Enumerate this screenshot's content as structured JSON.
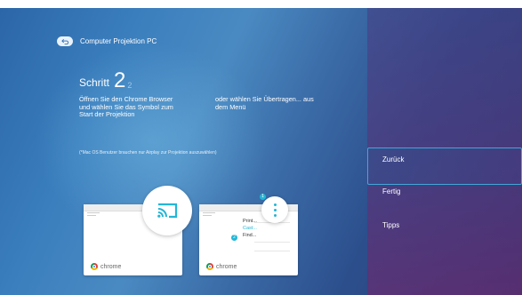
{
  "header": {
    "title": "Computer Projektion PC"
  },
  "step": {
    "label": "Schritt",
    "current": "2",
    "total": "2"
  },
  "instructions": {
    "left": [
      "Öffnen Sie den Chrome Browser",
      "und wählen Sie das Symbol zum",
      "Start der Projektion"
    ],
    "right": [
      "oder wählen Sie Übertragen... aus",
      "dem Menü"
    ]
  },
  "note": "(*Mac OS Benutzer brauchen nur Airplay zur Projektion auszuwählen)",
  "cards": {
    "left": {
      "browser_label": "chrome"
    },
    "right": {
      "browser_label": "chrome",
      "badge1": "1",
      "badge2": "2",
      "menu_items": [
        "Print...",
        "Cast...",
        "Find..."
      ]
    }
  },
  "nav": {
    "items": [
      "Zurück",
      "Fertig",
      "Tipps"
    ],
    "selected": "Zurück"
  },
  "colors": {
    "accent": "#23b6d6",
    "selection_border": "#3fa7d9"
  },
  "icons": {
    "back": "back-arrow-icon",
    "cast": "cast-icon",
    "menu": "more-vert-icon",
    "browser": "chrome-logo-icon"
  }
}
